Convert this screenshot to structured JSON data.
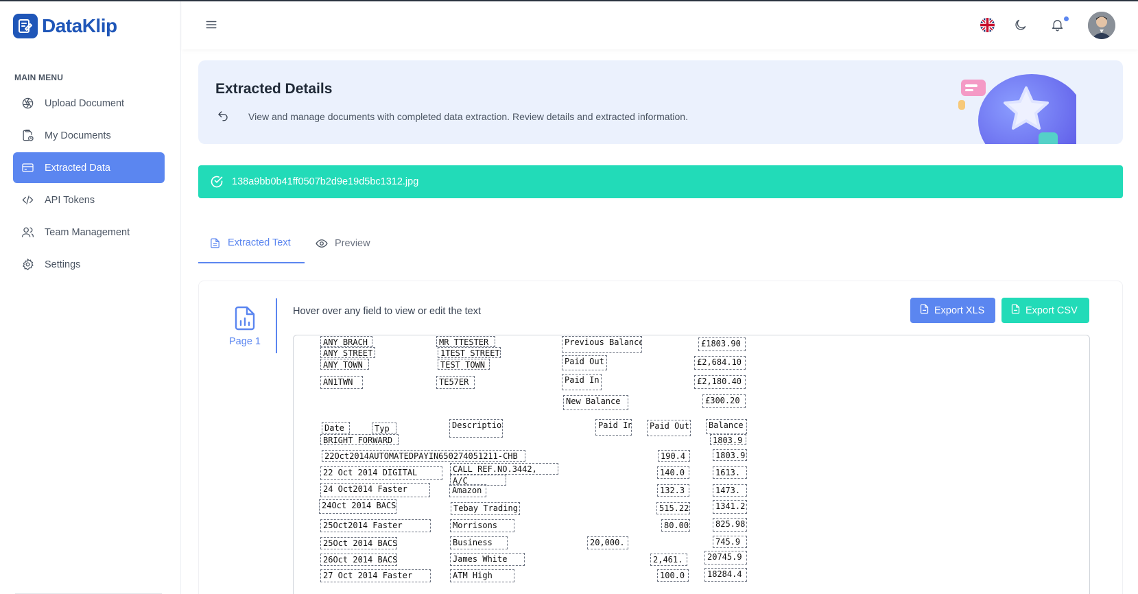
{
  "brand": {
    "name": "DataKlip"
  },
  "sidebar": {
    "heading": "MAIN MENU",
    "items": [
      {
        "label": "Upload Document",
        "icon": "aperture-icon",
        "active": false
      },
      {
        "label": "My Documents",
        "icon": "document-clock-icon",
        "active": false
      },
      {
        "label": "Extracted Data",
        "icon": "card-icon",
        "active": true
      },
      {
        "label": "API Tokens",
        "icon": "code-icon",
        "active": false
      },
      {
        "label": "Team Management",
        "icon": "users-icon",
        "active": false
      },
      {
        "label": "Settings",
        "icon": "gear-icon",
        "active": false
      }
    ]
  },
  "header": {
    "icons": [
      "hamburger-icon",
      "uk-flag-icon",
      "moon-icon",
      "bell-icon",
      "avatar"
    ]
  },
  "banner": {
    "title": "Extracted Details",
    "description": "View and manage documents with completed data extraction. Review details and extracted information."
  },
  "file": {
    "name": "138a9bb0b41ff0507b2d9e19d5bc1312.jpg"
  },
  "tabs": [
    {
      "label": "Extracted Text",
      "active": true
    },
    {
      "label": "Preview",
      "active": false
    }
  ],
  "page": {
    "label": "Page 1",
    "hint": "Hover over any field to view or edit the text",
    "export_xls": "Export XLS",
    "export_csv": "Export CSV"
  },
  "fields": [
    "ANY BRACH",
    "ANY STREET",
    "ANY TOWN",
    "AN1TWN",
    "MR TTESTER",
    "1TEST STREET",
    "TEST TOWN",
    "TE57ER",
    "Previous Balance",
    "Paid Out",
    "Paid In",
    "New Balance",
    "£1803.90",
    "£2,684.10",
    "£2,180.40",
    "£300.20",
    "Date",
    "Typ",
    "Description",
    "Paid In",
    "Paid Out",
    "Balance",
    "BRIGHT FORWARD",
    "1803.9",
    "22Oct2014AUTOMATEDPAYIN650274051211-CHB",
    "190.4",
    "1803.9",
    "22 Oct 2014 DIGITAL",
    "CALL REF.NO.3442,",
    "A/C",
    "140.0",
    "1613.",
    "24 Oct2014 Faster",
    "Amazon",
    "132.3",
    "1473.",
    "24Oct 2014 BACS",
    "Tebay Trading",
    "515.22",
    "1341.2",
    "25Oct2014 Faster",
    "Morrisons",
    "80.00",
    "825.98",
    "25Oct 2014 BACS",
    "Business",
    "20,000.",
    "745.9",
    "26Oct 2014 BACS",
    "James White",
    "2,461.",
    "20745.9",
    "27 Oct 2014 Faster",
    "ATM High",
    "100.0",
    "18284.4"
  ],
  "colors": {
    "primary": "#5b86f0",
    "success": "#22dbb8",
    "brand": "#1f56b8",
    "banner_bg": "#ebf1fd"
  }
}
